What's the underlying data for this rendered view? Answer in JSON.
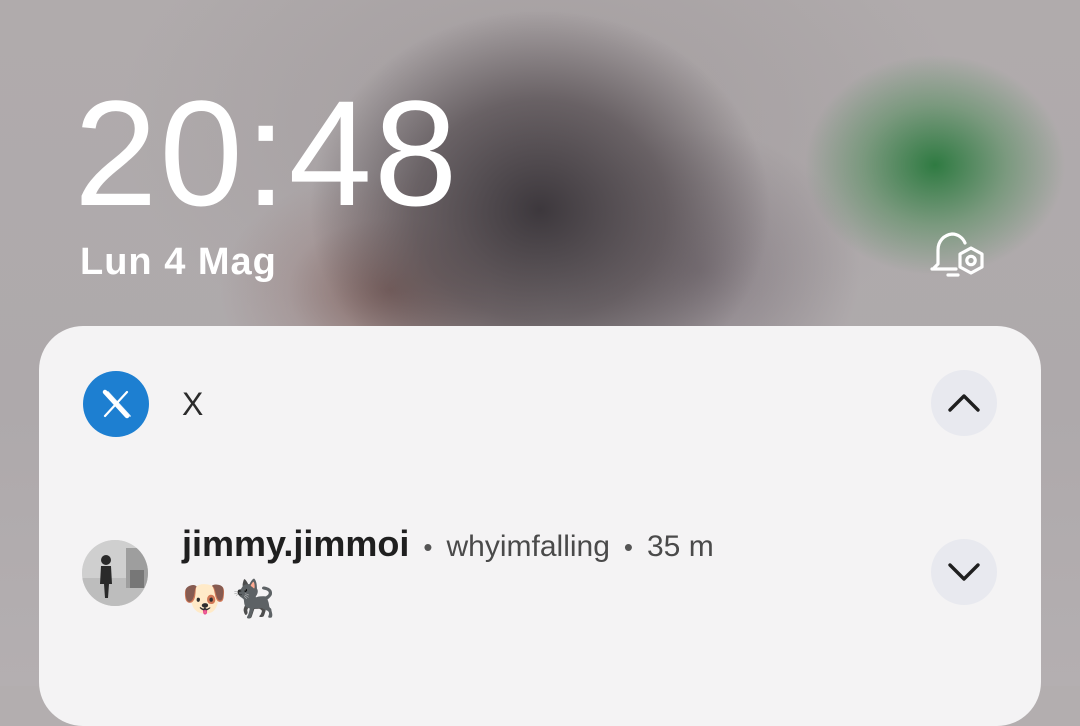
{
  "lockscreen": {
    "time": "20:48",
    "date": "Lun 4 Mag",
    "status_icon": "alarm-settings-icon"
  },
  "notification": {
    "app_name": "X",
    "app_icon": "x-logo-icon",
    "app_color": "#1d7fd1",
    "sender": "jimmy.jimmoi",
    "separator": "•",
    "account": "whyimfalling",
    "time_ago": "35 m",
    "message": "🐶🐈‍⬛",
    "collapse_icon": "chevron-up-icon",
    "expand_icon": "chevron-down-icon"
  }
}
